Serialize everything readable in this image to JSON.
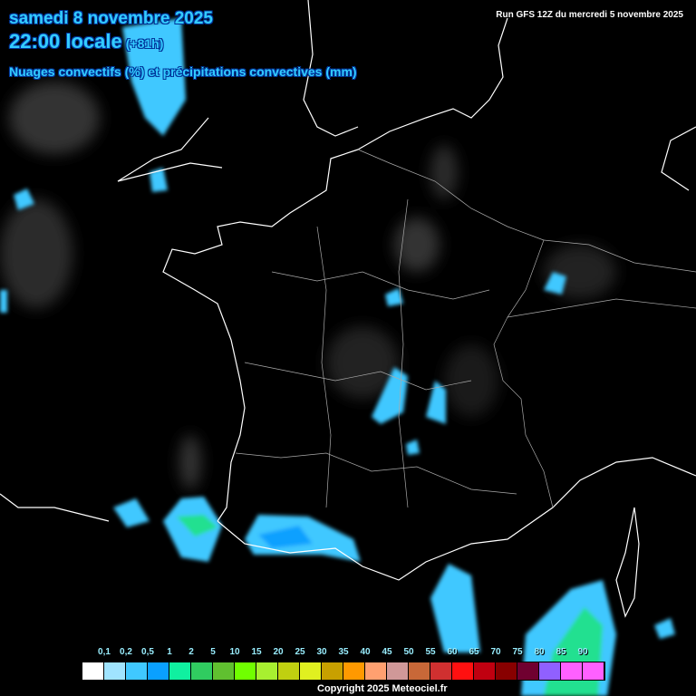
{
  "header": {
    "date": "samedi 8 novembre 2025",
    "time": "22:00 locale",
    "lead": "(+81h)",
    "subtitle": "Nuages convectifs (%) et précipitations convectives (mm)",
    "run": "Run GFS 12Z du mercredi 5 novembre 2025"
  },
  "legend": {
    "labels": [
      "0,1",
      "0,2",
      "0,5",
      "1",
      "2",
      "5",
      "10",
      "15",
      "20",
      "25",
      "30",
      "35",
      "40",
      "45",
      "50",
      "55",
      "60",
      "65",
      "70",
      "75",
      "80",
      "85",
      "90"
    ],
    "colors": [
      "#ffffff",
      "#a0e4ff",
      "#40c8ff",
      "#0aa0ff",
      "#10f0a0",
      "#30cc60",
      "#60c030",
      "#70ff00",
      "#a8f030",
      "#c0d010",
      "#e0f020",
      "#c8a000",
      "#ff9900",
      "#ffa070",
      "#d09898",
      "#c86838",
      "#d03030",
      "#ff1010",
      "#c00010",
      "#880000",
      "#700030",
      "#9060ff",
      "#ff60ff"
    ]
  },
  "copyright": "Copyright 2025 Meteociel.fr"
}
